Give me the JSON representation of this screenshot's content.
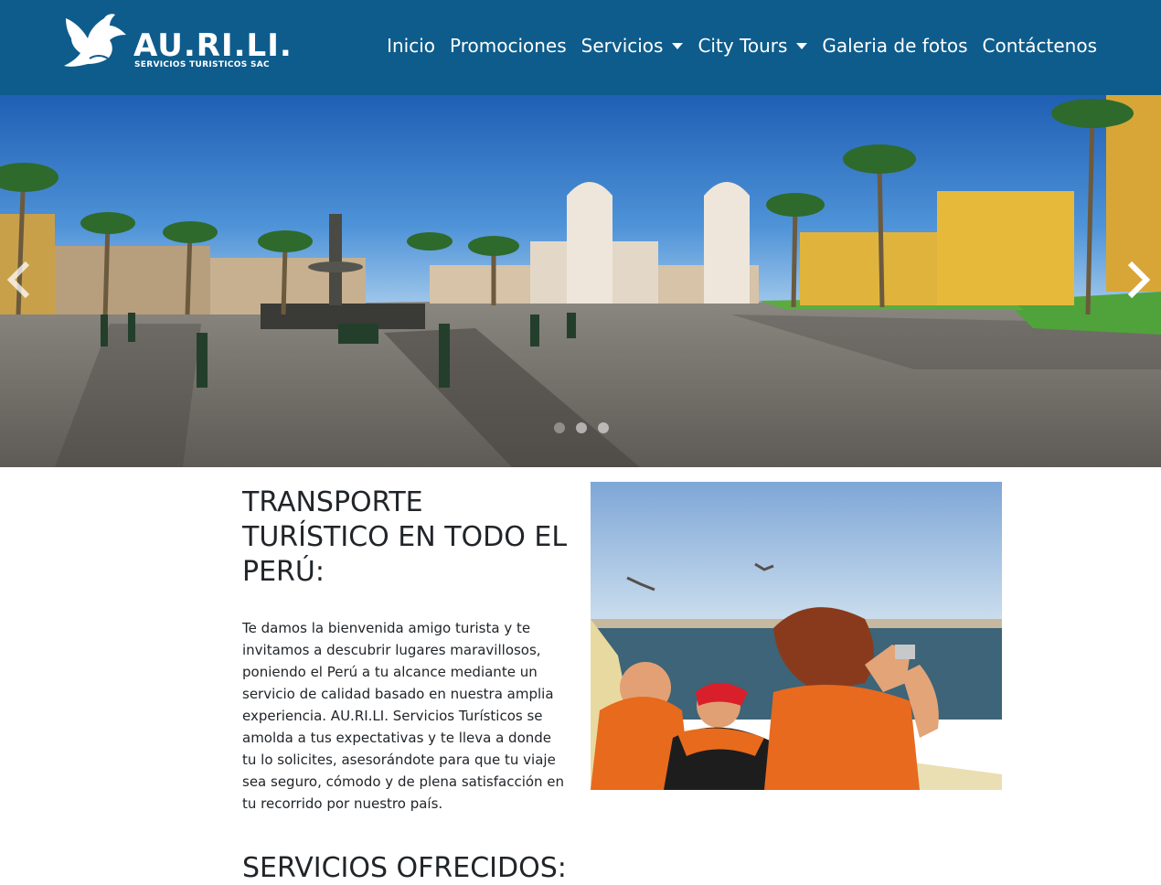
{
  "brand": {
    "name": "AU.RI.LI.",
    "tagline": "SERVICIOS TURISTICOS SAC"
  },
  "nav": {
    "items": [
      {
        "label": "Inicio",
        "dropdown": false
      },
      {
        "label": "Promociones",
        "dropdown": false
      },
      {
        "label": "Servicios",
        "dropdown": true
      },
      {
        "label": "City Tours",
        "dropdown": true
      },
      {
        "label": "Galeria de fotos",
        "dropdown": false
      },
      {
        "label": "Contáctenos",
        "dropdown": false
      }
    ]
  },
  "carousel": {
    "slides": 3,
    "active_index": 0,
    "image": "plaza-de-armas-lima"
  },
  "intro": {
    "title": "TRANSPORTE TURÍSTICO EN TODO EL PERÚ:",
    "text": "Te damos la bienvenida amigo turista y te invitamos a descubrir lugares maravillosos, poniendo el Perú a tu alcance mediante un servicio de calidad basado en nuestra amplia experiencia. AU.RI.LI. Servicios Turísticos se amolda a tus expectativas y te lleva a donde tu lo solicites, asesorándote para que tu viaje sea seguro, cómodo y de plena satisfacción en tu recorrido por nuestro país.",
    "image": "tourists-on-boat"
  },
  "services": {
    "title": "SERVICIOS OFRECIDOS:"
  },
  "colors": {
    "navbar": "#0e5c8b",
    "text": "#212529"
  }
}
